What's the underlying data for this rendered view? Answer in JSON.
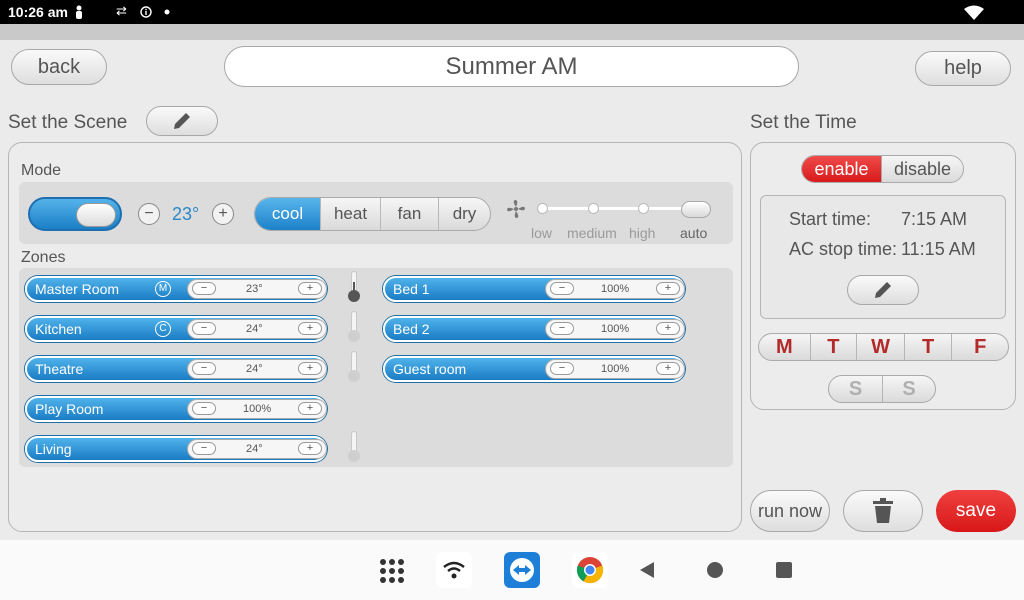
{
  "status": {
    "time": "10:26 am",
    "icons": [
      "person-icon",
      "data-transfer-icon",
      "info-icon",
      "dot-icon",
      "wifi-icon"
    ]
  },
  "header": {
    "back": "back",
    "title": "Summer AM",
    "help": "help"
  },
  "scene": {
    "label": "Set the Scene",
    "mode_label": "Mode",
    "temperature": "23°",
    "minus": "−",
    "plus": "+",
    "mode_on": true,
    "modes": [
      "cool",
      "heat",
      "fan",
      "dry"
    ],
    "active_mode": "cool",
    "fan_levels": [
      "low",
      "medium",
      "high",
      "auto"
    ],
    "active_fan": "auto"
  },
  "zones": {
    "label": "Zones",
    "left": [
      {
        "name": "Master Room",
        "value": "23°",
        "icon": "M"
      },
      {
        "name": "Kitchen",
        "value": "24°",
        "icon": "C"
      },
      {
        "name": "Theatre",
        "value": "24°",
        "icon": ""
      },
      {
        "name": "Play Room",
        "value": "100%",
        "icon": ""
      },
      {
        "name": "Living",
        "value": "24°",
        "icon": ""
      }
    ],
    "right": [
      {
        "name": "Bed 1",
        "value": "100%"
      },
      {
        "name": "Bed 2",
        "value": "100%"
      },
      {
        "name": "Guest room",
        "value": "100%"
      }
    ],
    "minus": "−",
    "plus": "+"
  },
  "time": {
    "label": "Set the Time",
    "enable": "enable",
    "disable": "disable",
    "enabled": true,
    "start_label": "Start time:",
    "start_value": "7:15 AM",
    "stop_label": "AC stop time:",
    "stop_value": "11:15 AM",
    "weekdays": [
      "M",
      "T",
      "W",
      "T",
      "F"
    ],
    "weekend": [
      "S",
      "S"
    ]
  },
  "actions": {
    "run_now": "run now",
    "save": "save"
  },
  "colors": {
    "accent_blue": "#1d82c9",
    "accent_red": "#d81818",
    "day_red": "#b22a2a"
  }
}
